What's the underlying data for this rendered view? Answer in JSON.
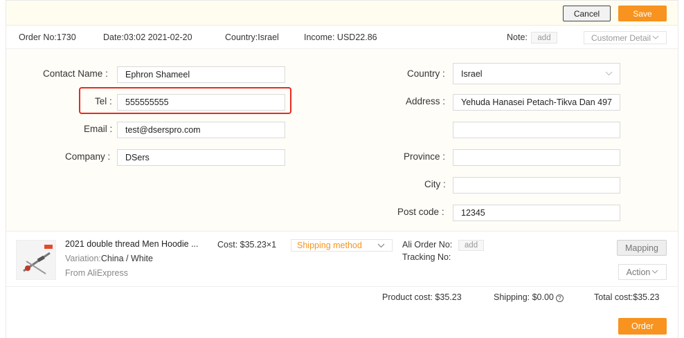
{
  "toolbar": {
    "cancel_label": "Cancel",
    "save_label": "Save"
  },
  "order_info": {
    "order_no": "Order No:1730",
    "date": "Date:03:02 2021-02-20",
    "country": "Country:Israel",
    "income": "Income: USD22.86",
    "note_label": "Note:",
    "note_add": "add",
    "customer_detail": "Customer Detail"
  },
  "form": {
    "contact_name": {
      "label": "Contact Name",
      "value": "Ephron  Shameel"
    },
    "tel": {
      "label": "Tel",
      "value": "555555555"
    },
    "email": {
      "label": "Email",
      "value": "test@dserspro.com"
    },
    "company": {
      "label": "Company",
      "value": "DSers"
    },
    "country": {
      "label": "Country",
      "value": "Israel"
    },
    "address": {
      "label": "Address",
      "value": "Yehuda Hanasei Petach-Tikva Dan 497",
      "line2": ""
    },
    "province": {
      "label": "Province",
      "value": ""
    },
    "city": {
      "label": "City",
      "value": ""
    },
    "post_code": {
      "label": "Post code",
      "value": "12345"
    },
    "colon": ":"
  },
  "product": {
    "title": "2021 double thread Men Hoodie ...",
    "variation_label": "Variation:",
    "variation_value": "China / White",
    "source": "From AliExpress",
    "cost": "Cost: $35.23×1",
    "shipping_method": "Shipping method",
    "ali_order_label": "Ali Order No:",
    "ali_order_add": "add",
    "tracking_label": "Tracking No:",
    "mapping_label": "Mapping",
    "action_label": "Action"
  },
  "totals": {
    "product_cost": "Product cost: $35.23",
    "shipping": "Shipping: $0.00",
    "total": "Total cost:$35.23",
    "order_label": "Order"
  },
  "colors": {
    "accent": "#f7931e",
    "highlight": "#e8291f"
  }
}
